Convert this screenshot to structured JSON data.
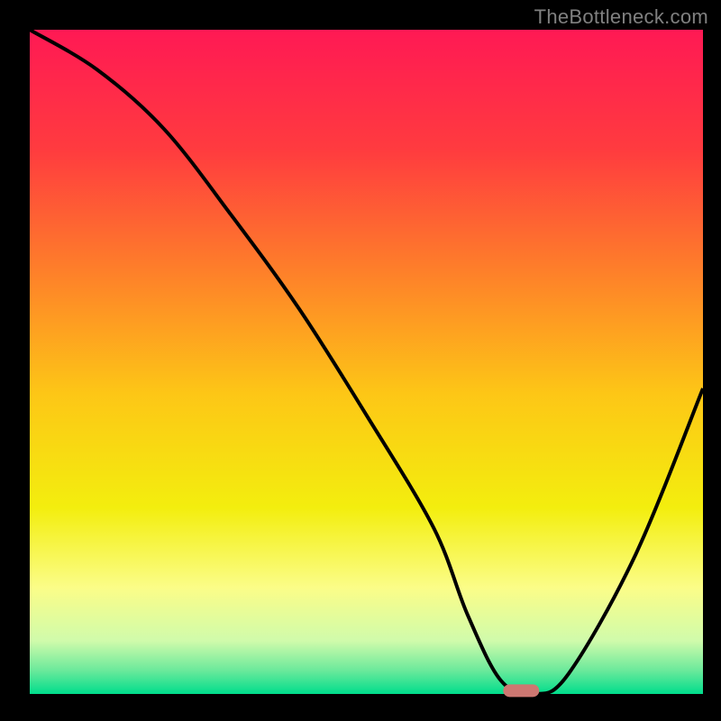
{
  "watermark": "TheBottleneck.com",
  "chart_data": {
    "type": "line",
    "title": "",
    "xlabel": "",
    "ylabel": "",
    "xlim": [
      0,
      100
    ],
    "ylim": [
      0,
      100
    ],
    "background_gradient": {
      "stops": [
        {
          "offset": 0.0,
          "color": "#ff1954"
        },
        {
          "offset": 0.18,
          "color": "#ff3b3f"
        },
        {
          "offset": 0.36,
          "color": "#fe7e2a"
        },
        {
          "offset": 0.55,
          "color": "#fdc716"
        },
        {
          "offset": 0.72,
          "color": "#f3ee0e"
        },
        {
          "offset": 0.84,
          "color": "#fbfd88"
        },
        {
          "offset": 0.92,
          "color": "#d0fbab"
        },
        {
          "offset": 0.965,
          "color": "#6ae99b"
        },
        {
          "offset": 1.0,
          "color": "#00dd8c"
        }
      ]
    },
    "x": [
      0,
      10,
      20,
      30,
      40,
      50,
      60,
      65,
      70,
      75,
      80,
      90,
      100
    ],
    "y": [
      100,
      94,
      85,
      72,
      58,
      42,
      25,
      12,
      2,
      0,
      3,
      21,
      46
    ],
    "marker": {
      "x": 73,
      "y": 0.5,
      "color": "#cd7771"
    }
  }
}
